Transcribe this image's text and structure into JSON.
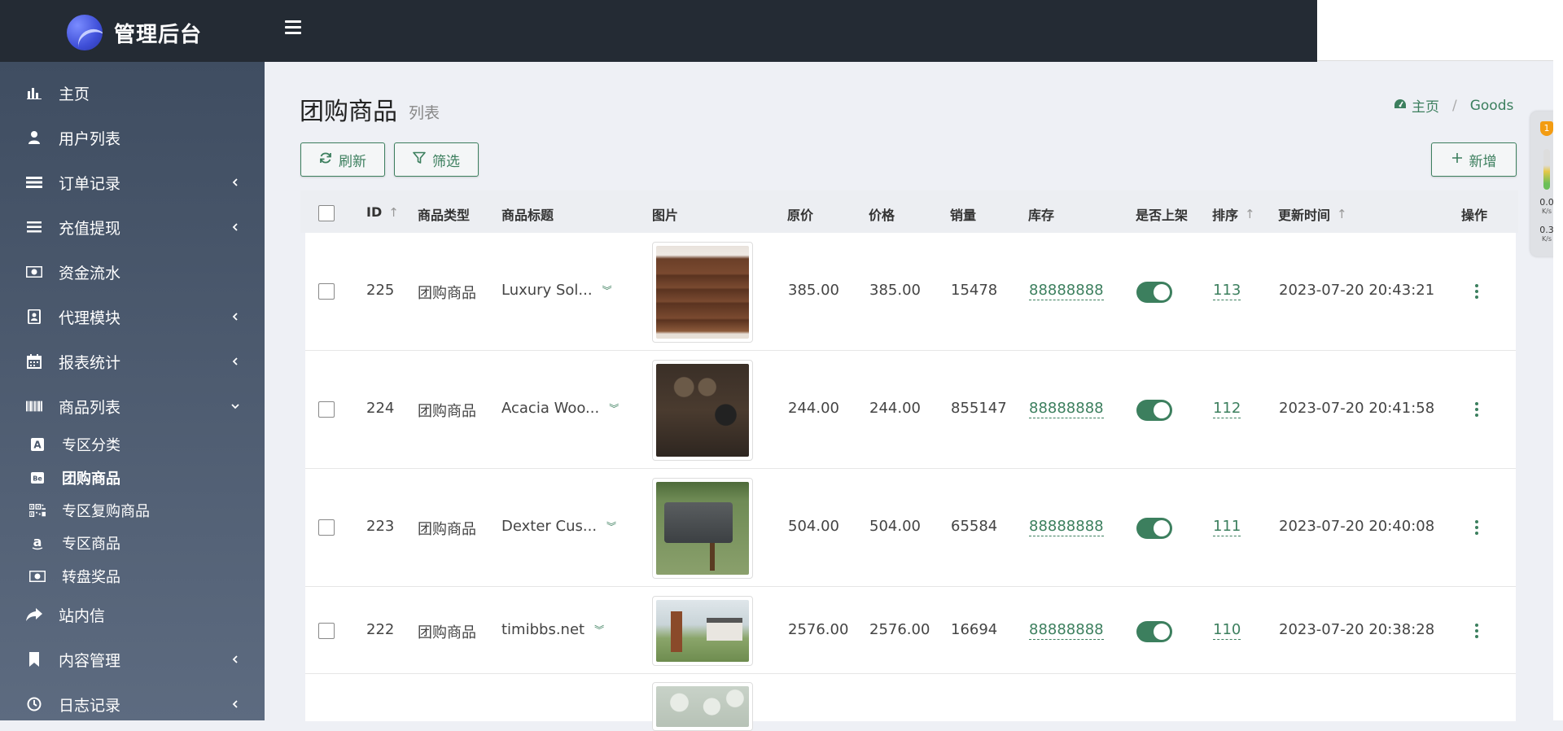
{
  "app": {
    "title": "管理后台"
  },
  "sidebar": {
    "items": [
      {
        "label": "主页",
        "icon": "bar-chart-icon",
        "has_children": false
      },
      {
        "label": "用户列表",
        "icon": "user-icon",
        "has_children": false
      },
      {
        "label": "订单记录",
        "icon": "list-icon",
        "has_children": true
      },
      {
        "label": "充值提现",
        "icon": "menu-icon",
        "has_children": true
      },
      {
        "label": "资金流水",
        "icon": "money-icon",
        "has_children": false
      },
      {
        "label": "代理模块",
        "icon": "address-book-icon",
        "has_children": true
      },
      {
        "label": "报表统计",
        "icon": "calendar-icon",
        "has_children": true
      },
      {
        "label": "商品列表",
        "icon": "barcode-icon",
        "has_children": true,
        "expanded": true
      }
    ],
    "sub_items": [
      {
        "label": "专区分类",
        "icon": "letter-a-icon",
        "active": false
      },
      {
        "label": "团购商品",
        "icon": "behance-icon",
        "active": true
      },
      {
        "label": "专区复购商品",
        "icon": "qrcode-icon",
        "active": false
      },
      {
        "label": "专区商品",
        "icon": "amazon-icon",
        "active": false
      },
      {
        "label": "转盘奖品",
        "icon": "money-icon",
        "active": false
      }
    ],
    "bottom_items": [
      {
        "label": "站内信",
        "icon": "share-icon",
        "has_children": false
      },
      {
        "label": "内容管理",
        "icon": "bookmark-icon",
        "has_children": true
      },
      {
        "label": "日志记录",
        "icon": "clock-icon",
        "has_children": true
      }
    ]
  },
  "page": {
    "title": "团购商品",
    "subtitle": "列表"
  },
  "breadcrumb": {
    "home": "主页",
    "current": "Goods"
  },
  "toolbar": {
    "refresh_label": "刷新",
    "filter_label": "筛选",
    "add_label": "新增"
  },
  "table": {
    "columns": [
      "ID",
      "商品类型",
      "商品标题",
      "图片",
      "原价",
      "价格",
      "销量",
      "库存",
      "是否上架",
      "排序",
      "更新时间",
      "操作"
    ],
    "rows": [
      {
        "id": "225",
        "type": "团购商品",
        "title": "Luxury Sol...",
        "image": "wooden-jewelry-cabinet",
        "original_price": "385.00",
        "price": "385.00",
        "sales": "15478",
        "stock": "88888888",
        "on_shelf": true,
        "sort": "113",
        "updated": "2023-07-20 20:43:21"
      },
      {
        "id": "224",
        "type": "团购商品",
        "title": "Acacia Woo...",
        "image": "watch-box-dark",
        "original_price": "244.00",
        "price": "244.00",
        "sales": "855147",
        "stock": "88888888",
        "on_shelf": true,
        "sort": "112",
        "updated": "2023-07-20 20:41:58"
      },
      {
        "id": "223",
        "type": "团购商品",
        "title": "Dexter Cus...",
        "image": "mailbox-2407",
        "original_price": "504.00",
        "price": "504.00",
        "sales": "65584",
        "stock": "88888888",
        "on_shelf": true,
        "sort": "111",
        "updated": "2023-07-20 20:40:08"
      },
      {
        "id": "222",
        "type": "团购商品",
        "title": "timibbs.net",
        "image": "brick-mailbox-house",
        "original_price": "2576.00",
        "price": "2576.00",
        "sales": "16694",
        "stock": "88888888",
        "on_shelf": true,
        "sort": "110",
        "updated": "2023-07-20 20:38:28"
      }
    ]
  },
  "widget": {
    "badge": "1",
    "up_value": "0.0",
    "up_unit": "K/s",
    "down_value": "0.3",
    "down_unit": "K/s"
  },
  "colors": {
    "accent": "#3c7f5e",
    "topbar": "#242b34",
    "sidebar_top": "#3f4d61",
    "sidebar_bottom": "#5d6b80"
  }
}
